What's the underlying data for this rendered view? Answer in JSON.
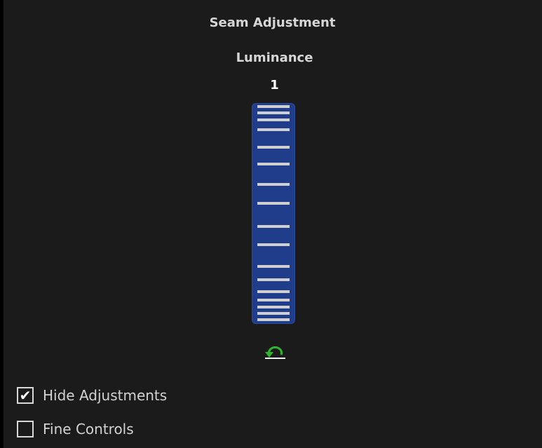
{
  "panel": {
    "title": "Seam Adjustment",
    "parameter_label": "Luminance",
    "parameter_value": "1",
    "reset_icon": "reset-undo-icon",
    "accent_color": "#2fb52f",
    "wheel_color": "#1f3d8a"
  },
  "options": {
    "hide_adjustments": {
      "label": "Hide Adjustments",
      "checked": true,
      "check_glyph": "✔"
    },
    "fine_controls": {
      "label": "Fine Controls",
      "checked": false,
      "check_glyph": ""
    }
  }
}
